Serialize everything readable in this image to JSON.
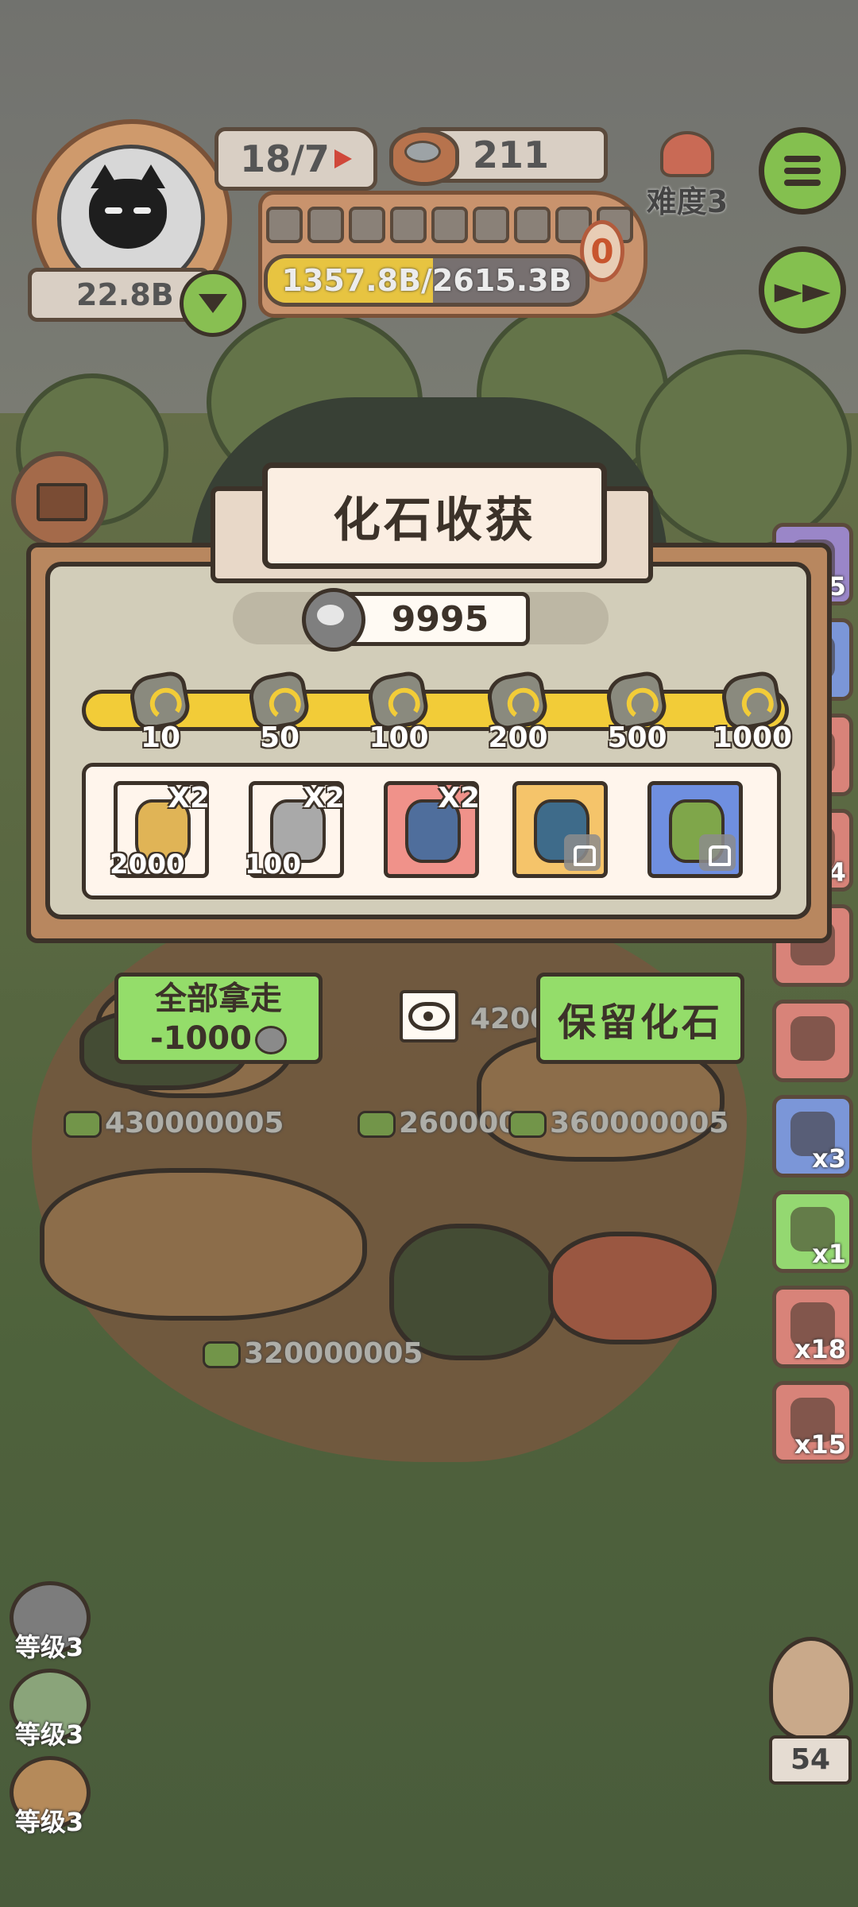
{
  "hud": {
    "wave": "18/7",
    "cans": "211",
    "difficulty": "难度3",
    "money": "22.8B",
    "progress_text": "1357.8B/2615.3B",
    "progress_fraction": 0.519,
    "zero_badge": "0"
  },
  "dialog": {
    "title": "化石收获",
    "fossil_count": "9995",
    "milestones": [
      "10",
      "50",
      "100",
      "200",
      "500",
      "1000"
    ],
    "rewards": [
      {
        "name": "paw-coin-bag",
        "mult": "X2",
        "qty": "2000",
        "color": "#fff5ec",
        "locked": false
      },
      {
        "name": "can-pack",
        "mult": "X2",
        "qty": "100",
        "color": "#fff5ec",
        "locked": false
      },
      {
        "name": "sea-creature",
        "mult": "X2",
        "qty": "",
        "color": "#f0928a",
        "locked": false
      },
      {
        "name": "blue-dinosaur",
        "mult": "",
        "qty": "",
        "color": "#f5c46a",
        "locked": true
      },
      {
        "name": "green-can",
        "mult": "",
        "qty": "",
        "color": "#6f8fe0",
        "locked": true
      }
    ],
    "take_all_line1": "全部拿走",
    "take_all_line2": "-1000",
    "keep_label": "保留化石"
  },
  "field_amounts": [
    "430000005",
    "260000",
    "360000005",
    "320000005",
    "4200"
  ],
  "side_items": [
    {
      "count": "95",
      "color": "#9a86c8"
    },
    {
      "count": "",
      "color": "#7b96d8"
    },
    {
      "count": "",
      "color": "#d88379"
    },
    {
      "count": "",
      "color": "#d88379"
    },
    {
      "count": "4",
      "color": "#d88379"
    },
    {
      "count": "",
      "color": "#d88379"
    },
    {
      "count": "",
      "color": "#d88379"
    },
    {
      "count": "x3",
      "color": "#7b96d8"
    },
    {
      "count": "x1",
      "color": "#94d871"
    },
    {
      "count": "x18",
      "color": "#d88379"
    },
    {
      "count": "x15",
      "color": "#d88379"
    }
  ],
  "levels": [
    "等级3",
    "等级3",
    "等级3"
  ],
  "owl_count": "54"
}
